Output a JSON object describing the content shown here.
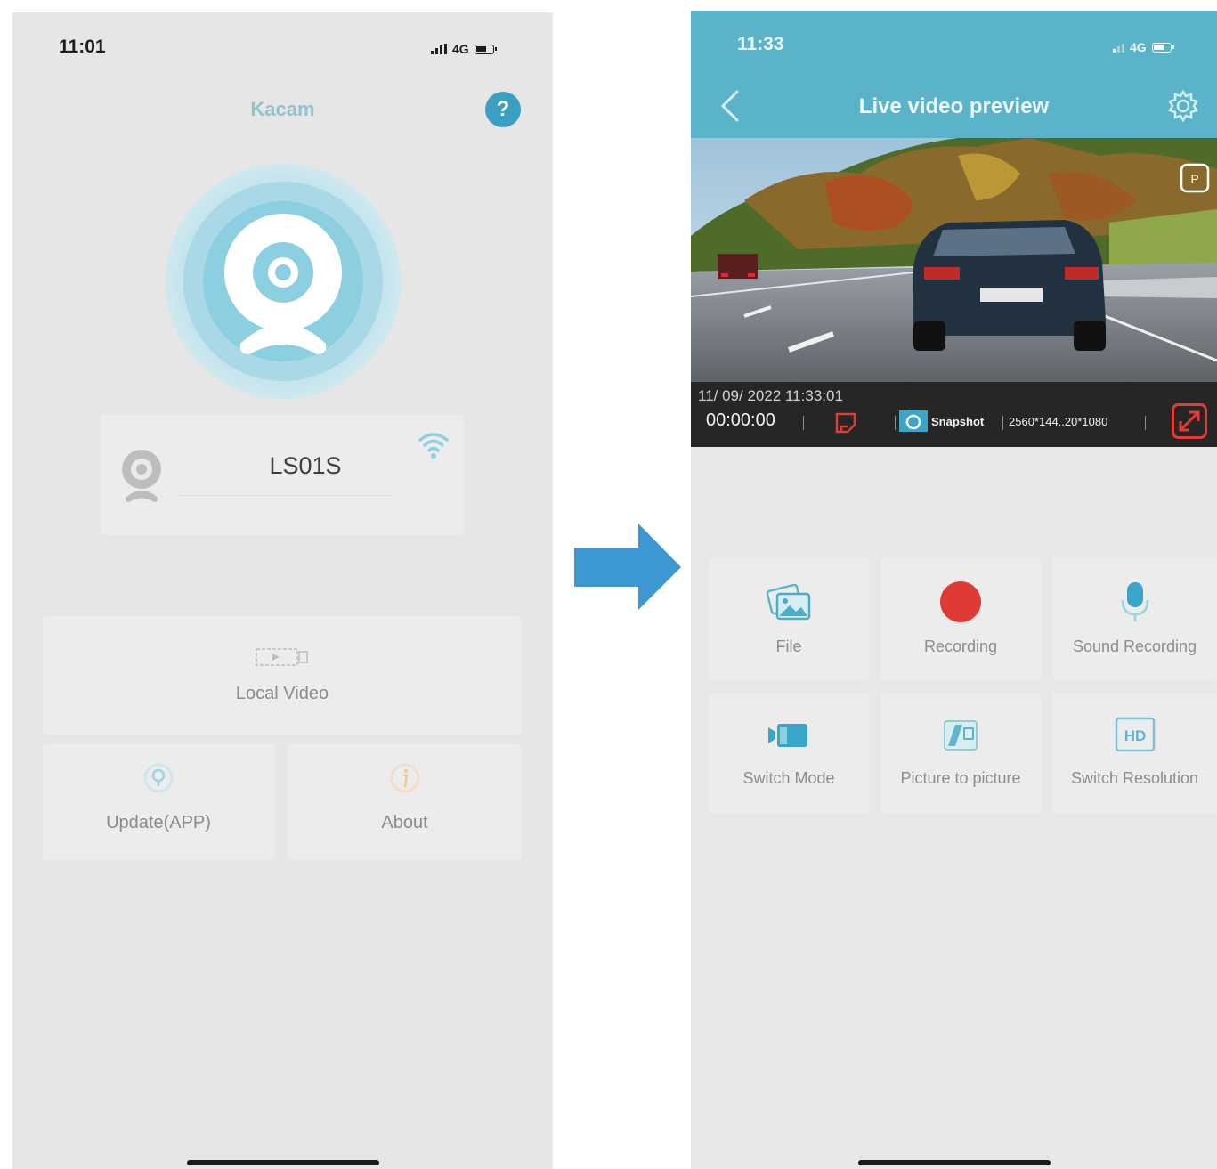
{
  "left_screen": {
    "status": {
      "time": "11:01",
      "network": "4G"
    },
    "title": "Kacam",
    "help_icon_glyph": "?",
    "device": {
      "name": "LS01S"
    },
    "menu": {
      "local_video": "Local Video",
      "update_app": "Update(APP)",
      "about": "About"
    },
    "icons": {
      "help": "help-icon",
      "webcam": "webcam-icon",
      "wifi": "wifi-icon",
      "video": "video-icon",
      "update": "update-icon",
      "about": "info-icon"
    }
  },
  "right_screen": {
    "status": {
      "time": "11:33",
      "network": "4G"
    },
    "title": "Live video preview",
    "video_overlay": {
      "datetime": "11/ 09/ 2022  11:33:01",
      "timer": "00:00:00",
      "snapshot": "Snapshot",
      "resolution": "2560*144..20*1080",
      "pip_badge": "P"
    },
    "tiles": [
      {
        "label": "File",
        "icon": "gallery-icon"
      },
      {
        "label": "Recording",
        "icon": "record-icon"
      },
      {
        "label": "Sound Recording",
        "icon": "microphone-icon"
      },
      {
        "label": "Switch Mode",
        "icon": "video-camera-icon"
      },
      {
        "label": "Picture to picture",
        "icon": "pip-icon"
      },
      {
        "label": "Switch Resolution",
        "icon": "hd-icon"
      }
    ],
    "hd_badge": "HD"
  },
  "colors": {
    "accent": "#5ab3c8",
    "help_button": "#3a9fc2",
    "record_red": "#e03a36",
    "bg": "#e6e6e6",
    "card": "#ececec"
  }
}
